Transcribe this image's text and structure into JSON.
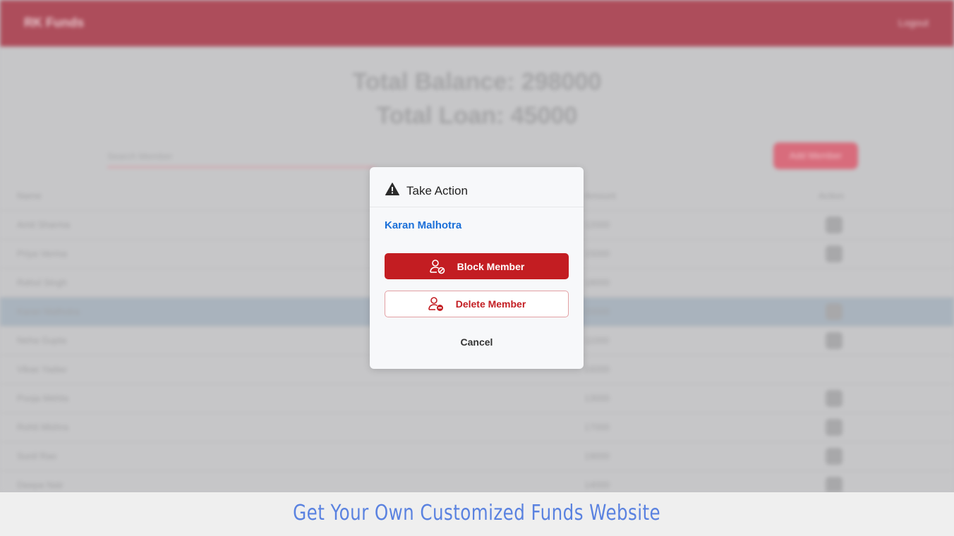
{
  "app": {
    "brand": "RK Funds",
    "logout_label": "Logout"
  },
  "summary": {
    "total_balance": "Total Balance: 298000",
    "total_loan": "Total Loan: 45000"
  },
  "search": {
    "placeholder": "Search Member"
  },
  "add_button_label": "Add Member",
  "table": {
    "headers": {
      "name": "Name",
      "amount": "Amount",
      "action": "Action"
    },
    "rows": [
      {
        "name": "Amit Sharma",
        "amount": "12000"
      },
      {
        "name": "Priya Verma",
        "amount": "15000"
      },
      {
        "name": "Rahul Singh",
        "amount": "18000"
      },
      {
        "name": "Karan Malhotra",
        "amount": "20000"
      },
      {
        "name": "Neha Gupta",
        "amount": "11000"
      },
      {
        "name": "Vikas Yadav",
        "amount": "16000"
      },
      {
        "name": "Pooja Mehta",
        "amount": "13000"
      },
      {
        "name": "Rohit Mishra",
        "amount": "17000"
      },
      {
        "name": "Sunil Rao",
        "amount": "19000"
      },
      {
        "name": "Deepa Nair",
        "amount": "14000"
      }
    ]
  },
  "modal": {
    "title": "Take Action",
    "member_name": "Karan Malhotra",
    "block_label": "Block Member",
    "delete_label": "Delete Member",
    "cancel_label": "Cancel",
    "icons": {
      "header": "warning-icon",
      "block": "user-block-icon",
      "delete": "user-remove-icon"
    }
  },
  "banner": {
    "text": "Get Your Own Customized Funds Website"
  },
  "colors": {
    "primary_red": "#c31d22",
    "link_blue": "#1a6fd8",
    "banner_blue": "#5a82e0",
    "topbar": "#ad4d5b"
  }
}
